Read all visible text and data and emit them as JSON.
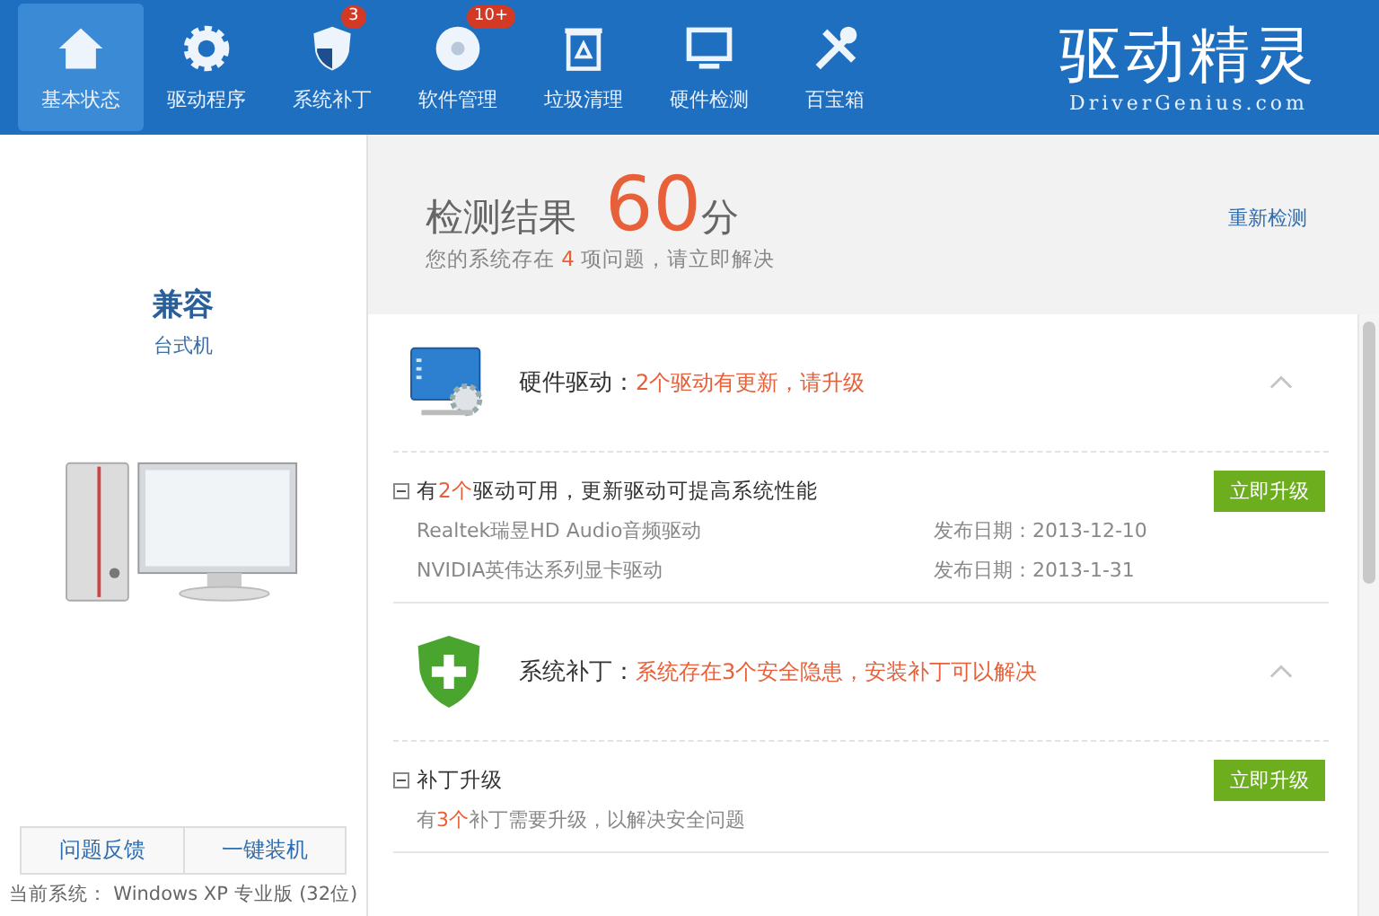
{
  "nav": {
    "items": [
      {
        "label": "基本状态",
        "kind": "house",
        "selected": true
      },
      {
        "label": "驱动程序",
        "kind": "gear",
        "selected": false
      },
      {
        "label": "系统补丁",
        "kind": "shield",
        "selected": false,
        "badge": "3"
      },
      {
        "label": "软件管理",
        "kind": "disc",
        "selected": false,
        "badge": "10+"
      },
      {
        "label": "垃圾清理",
        "kind": "bin",
        "selected": false
      },
      {
        "label": "硬件检测",
        "kind": "monitor",
        "selected": false
      },
      {
        "label": "百宝箱",
        "kind": "tools",
        "selected": false
      }
    ],
    "logo": {
      "name": "驱动精灵",
      "site": "DriverGenius.com"
    }
  },
  "sidebar": {
    "computer_name": "兼容",
    "computer_type": "台式机",
    "buttons": [
      "问题反馈",
      "一键装机"
    ],
    "current_system": "当前系统： Windows XP 专业版 (32位)"
  },
  "result": {
    "title": "检测结果",
    "score": "60",
    "unit": "分",
    "summary": "您的系统存在 **4** 项问题，请立即解决",
    "rescan": "重新检测"
  },
  "sections": [
    {
      "kind": "hardware",
      "title": "硬件驱动：",
      "status": "2个驱动有更新，请升级",
      "expanded": true,
      "groups": [
        {
          "heading": "有**2个**驱动可用，更新驱动可提高系统性能",
          "expanded": true,
          "button": "立即升级",
          "kind": "list",
          "items": [
            {
              "name": "Realtek瑞昱HD Audio音频驱动",
              "date": "发布日期：2013-12-10"
            },
            {
              "name": "NVIDIA英伟达系列显卡驱动",
              "date": "发布日期：2013-1-31"
            }
          ]
        }
      ]
    },
    {
      "kind": "patch",
      "title": "系统补丁：",
      "status": "系统存在3个安全隐患，安装补丁可以解决",
      "expanded": true,
      "groups": [
        {
          "heading": "补丁升级",
          "expanded": true,
          "button": "立即升级",
          "kind": "note",
          "note": "有**3个**补丁需要升级，以解决安全问题"
        }
      ]
    }
  ]
}
